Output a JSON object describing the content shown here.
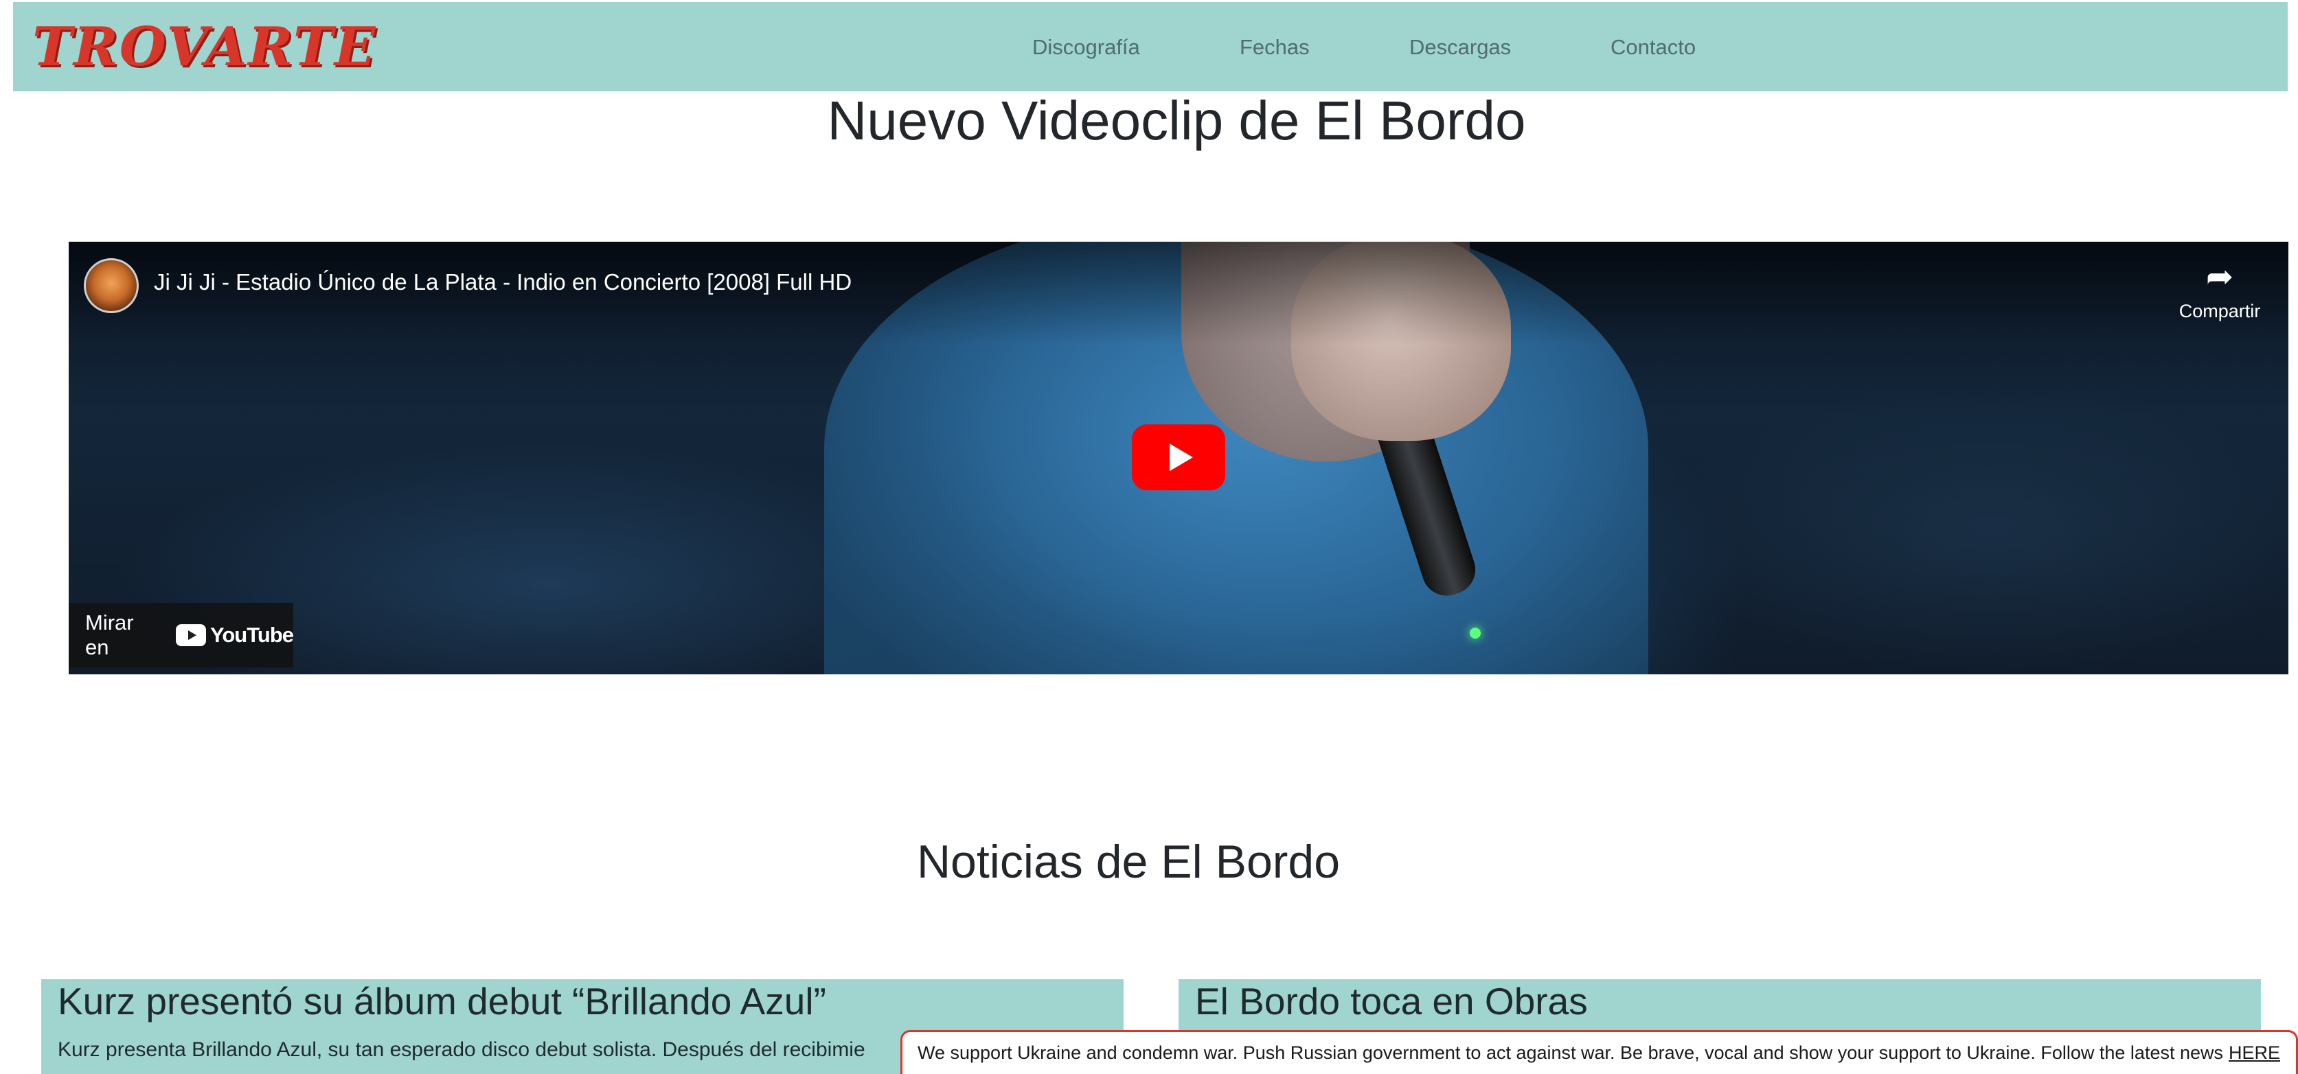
{
  "nav": {
    "logo": "TROVARTE",
    "links": [
      "Discografía",
      "Fechas",
      "Descargas",
      "Contacto"
    ]
  },
  "video_section": {
    "title": "Nuevo Videoclip de El Bordo",
    "video": {
      "title": "Ji Ji Ji - Estadio Único de La Plata - Indio en Concierto [2008] Full HD",
      "share_label": "Compartir",
      "share_icon": "share-arrow-icon",
      "play_icon": "play-icon",
      "watch_on_label": "Mirar en",
      "youtube_wordmark": "YouTube"
    }
  },
  "news_section": {
    "title": "Noticias de El Bordo",
    "cards": [
      {
        "title": "Kurz presentó su álbum debut “Brillando Azul”",
        "text": "Kurz presenta Brillando Azul, su tan esperado disco debut solista. Después del recibimie"
      },
      {
        "title": "El Bordo toca en Obras",
        "text": ""
      }
    ]
  },
  "banner": {
    "text": "We support Ukraine and condemn war. Push Russian government to act against war. Be brave, vocal and show your support to Ukraine. Follow the latest news",
    "link": "HERE",
    "border_color": "#d9362b"
  },
  "colors": {
    "nav_bg": "#9fd4cf",
    "logo": "#d9362b",
    "youtube_red": "#ff0000"
  }
}
